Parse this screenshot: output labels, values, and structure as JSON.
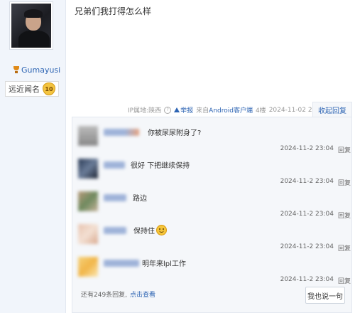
{
  "poster": {
    "username": "Gumayusi",
    "level_label": "远近闻名",
    "level_number": "10"
  },
  "post": {
    "text": "兄弟们我打得怎么样",
    "meta": {
      "ip": "IP属地:陕西",
      "report": "举报",
      "source": "来自Android客户端",
      "floor": "4楼",
      "time": "2024-11-02 23:04",
      "collapse": "收起回复"
    }
  },
  "replies": [
    {
      "text": "你被尿尿附身了?",
      "time": "2024-11-2 23:04",
      "reply": "回复"
    },
    {
      "text": "很好 下把继续保持",
      "time": "2024-11-2 23:04",
      "reply": "回复"
    },
    {
      "text": "路边",
      "time": "2024-11-2 23:04",
      "reply": "回复"
    },
    {
      "text": "保持住",
      "time": "2024-11-2 23:04",
      "reply": "回复"
    },
    {
      "text": "明年来lpl工作",
      "time": "2024-11-2 23:04",
      "reply": "回复"
    }
  ],
  "footer": {
    "more_count": "还有249条回复,",
    "more_link": "点击查看",
    "say_button": "我也说一句"
  }
}
